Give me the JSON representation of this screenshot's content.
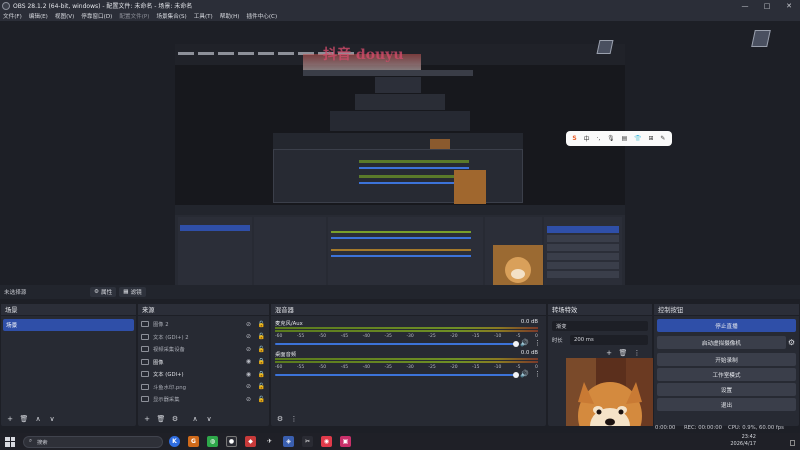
{
  "window": {
    "title": "OBS 28.1.2 (64-bit, windows) - 配置文件: 未命名 - 场景: 未命名",
    "controls": [
      "—",
      "□",
      "✕"
    ]
  },
  "menu": [
    "文件(F)",
    "编辑(E)",
    "视图(V)",
    "停靠窗口(D)",
    "配置文件(P)",
    "场景集合(S)",
    "工具(T)",
    "帮助(H)",
    "插件中心(C)"
  ],
  "scene_bar": {
    "current": "未选择源",
    "properties_label": "属性",
    "filters_label": "滤镜"
  },
  "floating_toolbar": [
    "S",
    "中",
    "·,",
    "🎙",
    "▤",
    "👕",
    "⊞",
    "✎"
  ],
  "scenes": {
    "header": "场景",
    "items": [
      "场景"
    ]
  },
  "sources": {
    "header": "来源",
    "items": [
      {
        "name": "图像 2",
        "bright": false
      },
      {
        "name": "文本 (GDI+) 2",
        "bright": false
      },
      {
        "name": "视频采集设备",
        "bright": false
      },
      {
        "name": "图像",
        "bright": true
      },
      {
        "name": "文本 (GDI+)",
        "bright": true
      },
      {
        "name": "斗鱼水印.png",
        "bright": false
      },
      {
        "name": "显示器采集",
        "bright": false
      }
    ]
  },
  "mixer": {
    "header": "混音器",
    "channels": [
      {
        "name": "麦克风/Aux",
        "db": "0.0 dB"
      },
      {
        "name": "桌面音频",
        "db": "0.0 dB"
      }
    ],
    "ticks": [
      "-60",
      "-55",
      "-50",
      "-45",
      "-40",
      "-35",
      "-30",
      "-25",
      "-20",
      "-15",
      "-10",
      "-5",
      "0"
    ]
  },
  "transitions": {
    "header": "转场特效",
    "type": "渐变",
    "duration_label": "时长",
    "duration_value": "200 ms"
  },
  "controls": {
    "header": "控制按钮",
    "buttons": [
      {
        "label": "停止直播",
        "active": true
      },
      {
        "label": "启动虚拟摄像机",
        "active": false
      },
      {
        "label": "开始录制",
        "active": false
      },
      {
        "label": "工作室模式",
        "active": false
      },
      {
        "label": "设置",
        "active": false
      },
      {
        "label": "退出",
        "active": false
      }
    ]
  },
  "status": {
    "stream_time": "0:00:00",
    "rec": "REC: 00:00:00",
    "cpu": "CPU: 0.9%, 60.00 fps"
  },
  "taskbar": {
    "search_placeholder": "搜索",
    "time": "23:42",
    "date": "2026/4/17"
  },
  "watermark_text": "抖音 douyu"
}
